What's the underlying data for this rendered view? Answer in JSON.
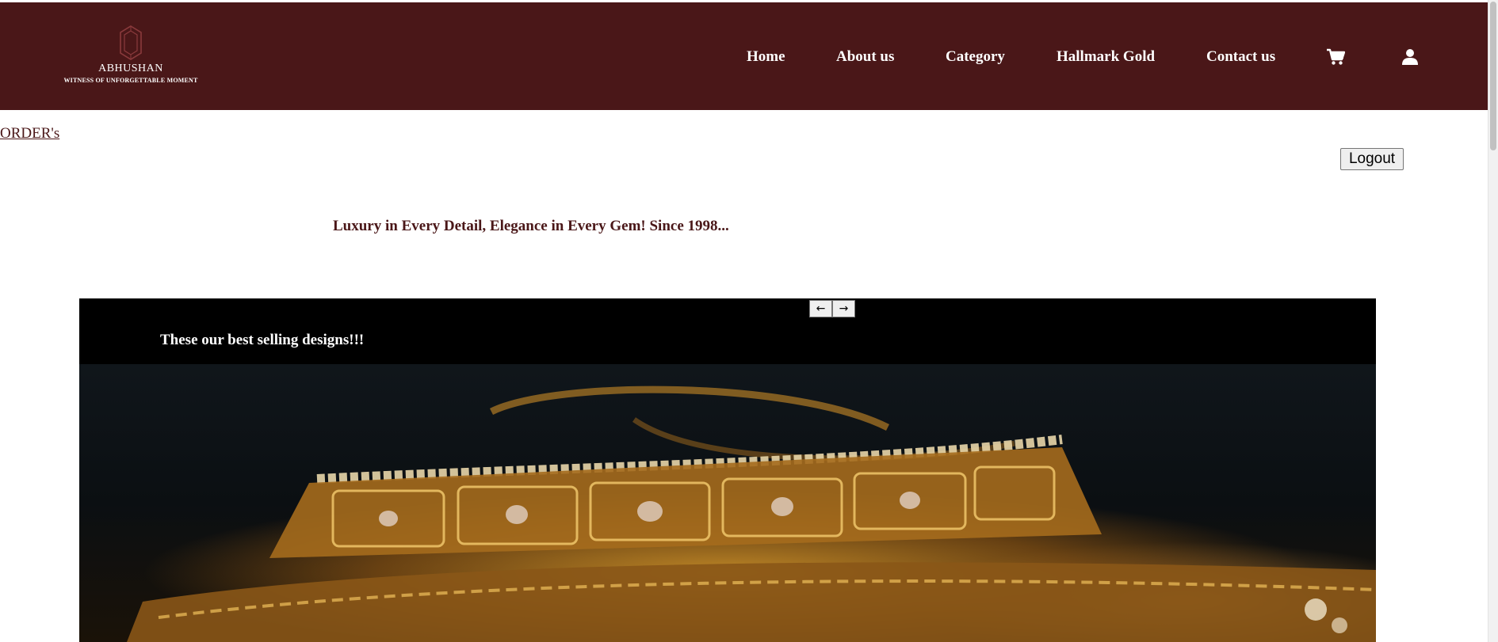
{
  "brand": {
    "name": "ABHUSHAN",
    "tagline": "WITNESS OF UNFORGETTABLE MOMENT"
  },
  "nav": {
    "home": "Home",
    "about": "About us",
    "category": "Category",
    "hallmark": "Hallmark Gold",
    "contact": "Contact us",
    "cart_icon": "cart-icon",
    "user_icon": "user-icon"
  },
  "orders_link": "ORDER's",
  "logout_label": "Logout",
  "slogan": "Luxury in Every Detail, Elegance in Every Gem! Since 1998...",
  "carousel": {
    "heading": "These our best selling designs!!!",
    "prev_label": "←",
    "next_label": "→"
  },
  "colors": {
    "header_bg": "#4a1718",
    "accent_text": "#4a1718",
    "carousel_bg": "#000000"
  }
}
